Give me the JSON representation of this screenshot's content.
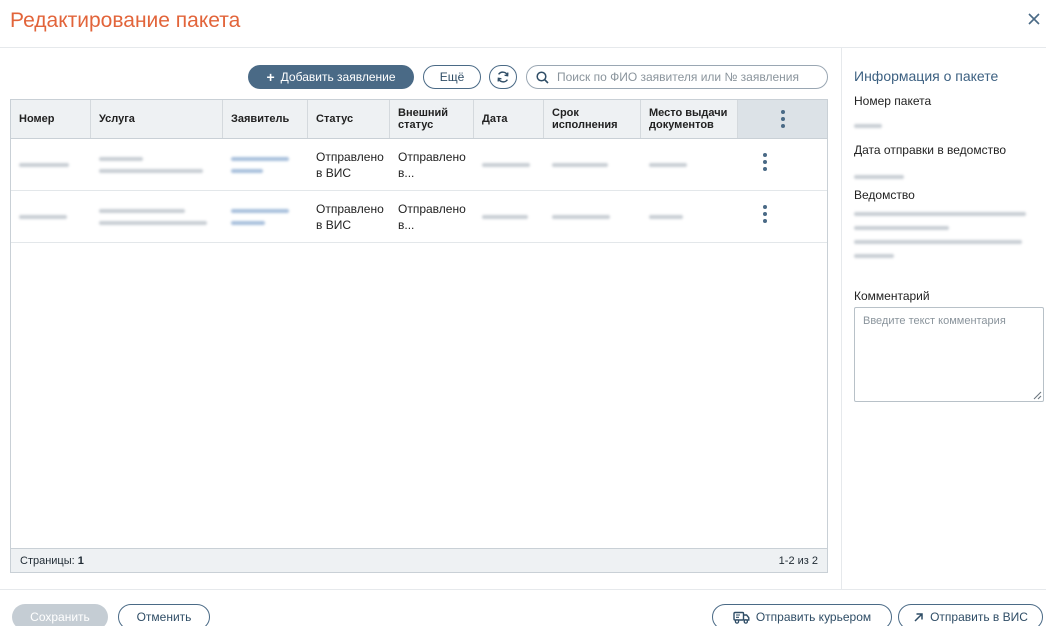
{
  "dialog": {
    "title": "Редактирование пакета",
    "close_icon": "close-icon"
  },
  "toolbar": {
    "add_label": "Добавить заявление",
    "more_label": "Ещё",
    "refresh_icon": "refresh-icon",
    "search_placeholder": "Поиск по ФИО заявителя или № заявления"
  },
  "table": {
    "columns": [
      "Номер",
      "Услуга",
      "Заявитель",
      "Статус",
      "Внешний статус",
      "Дата",
      "Срок исполнения",
      "Место выдачи документов"
    ],
    "rows": [
      {
        "status": "Отправлено в ВИС",
        "external_status": "Отправлено в..."
      },
      {
        "status": "Отправлено в ВИС",
        "external_status": "Отправлено в..."
      }
    ],
    "footer": {
      "pages_label": "Страницы:",
      "pages_value": "1",
      "range": "1-2 из 2"
    }
  },
  "sidebar": {
    "title": "Информация о пакете",
    "package_number_label": "Номер пакета",
    "sent_date_label": "Дата отправки в ведомство",
    "department_label": "Ведомство",
    "comment_label": "Комментарий",
    "comment_placeholder": "Введите текст комментария"
  },
  "footer": {
    "save_label": "Сохранить",
    "cancel_label": "Отменить",
    "courier_label": "Отправить курьером",
    "send_label": "Отправить в ВИС"
  },
  "colors": {
    "title": "#e2643a",
    "accent": "#4a6a86",
    "sidebar_title": "#3d6182"
  }
}
